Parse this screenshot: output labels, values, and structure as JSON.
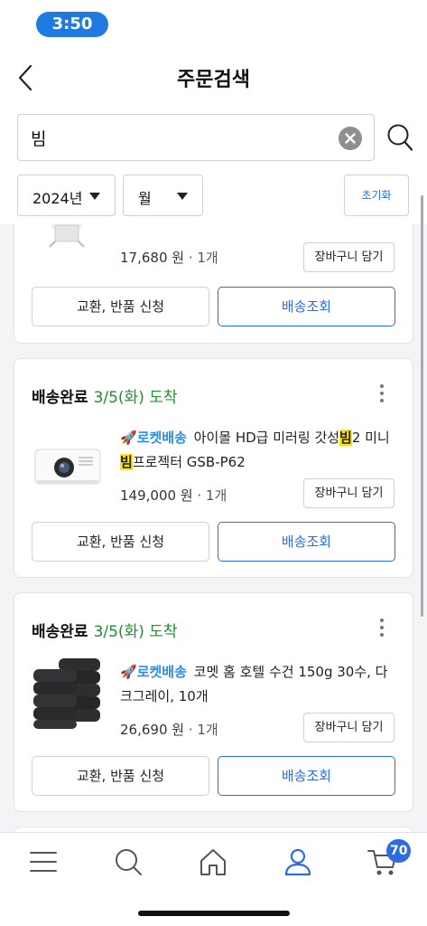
{
  "status_bar": {
    "time": "3:50"
  },
  "header": {
    "title": "주문검색"
  },
  "search": {
    "value": "빔"
  },
  "filters": {
    "year": "2024년",
    "month": "월",
    "reset_label": "초기화"
  },
  "orders": [
    {
      "price": "17,680 원",
      "qty": " · 1개",
      "cart_label": "장바구니 담기",
      "exchange_label": "교환, 반품 신청",
      "track_label": "배송조회"
    },
    {
      "status": "배송완료",
      "arrival": "3/5(화) 도착",
      "shipping_badge": "로켓배송",
      "title_pre": " 아이몰 HD급 미러링 갓성",
      "title_hl1": "빔",
      "title_mid": "2 미니 ",
      "title_hl2": "빔",
      "title_post": "프로젝터 GSB-P62",
      "price": "149,000 원",
      "qty": " · 1개",
      "cart_label": "장바구니 담기",
      "exchange_label": "교환, 반품 신청",
      "track_label": "배송조회"
    },
    {
      "status": "배송완료",
      "arrival": "3/5(화) 도착",
      "shipping_badge": "로켓배송",
      "title": " 코멧 홈 호텔 수건 150g 30수, 다크그레이, 10개",
      "price": "26,690 원",
      "qty": " · 1개",
      "cart_label": "장바구니 담기",
      "exchange_label": "교환, 반품 신청",
      "track_label": "배송조회"
    }
  ],
  "tabbar": {
    "cart_count": "70"
  },
  "colors": {
    "accent": "#2b6de0",
    "arrive_green": "#1f8f2f",
    "highlight": "#ffe600"
  }
}
